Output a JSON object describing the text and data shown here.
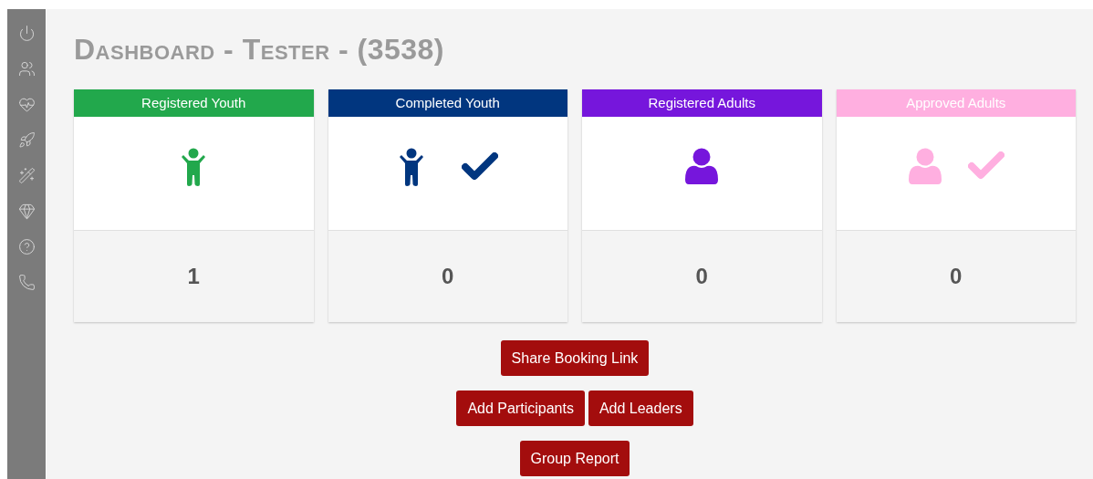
{
  "title": "Dashboard - Tester - (3538)",
  "cards": [
    {
      "label": "Registered Youth",
      "color": "#22a84c",
      "kind": "youth",
      "count": "1"
    },
    {
      "label": "Completed Youth",
      "color": "#01367f",
      "kind": "youth_check",
      "count": "0"
    },
    {
      "label": "Registered Adults",
      "color": "#7616dc",
      "kind": "adult",
      "count": "0"
    },
    {
      "label": "Approved Adults",
      "color": "#ffafe0",
      "kind": "adult_check",
      "count": "0"
    }
  ],
  "button_rows": [
    [
      "Share Booking Link"
    ],
    [
      "Add Participants",
      "Add Leaders"
    ],
    [
      "Group Report"
    ]
  ]
}
